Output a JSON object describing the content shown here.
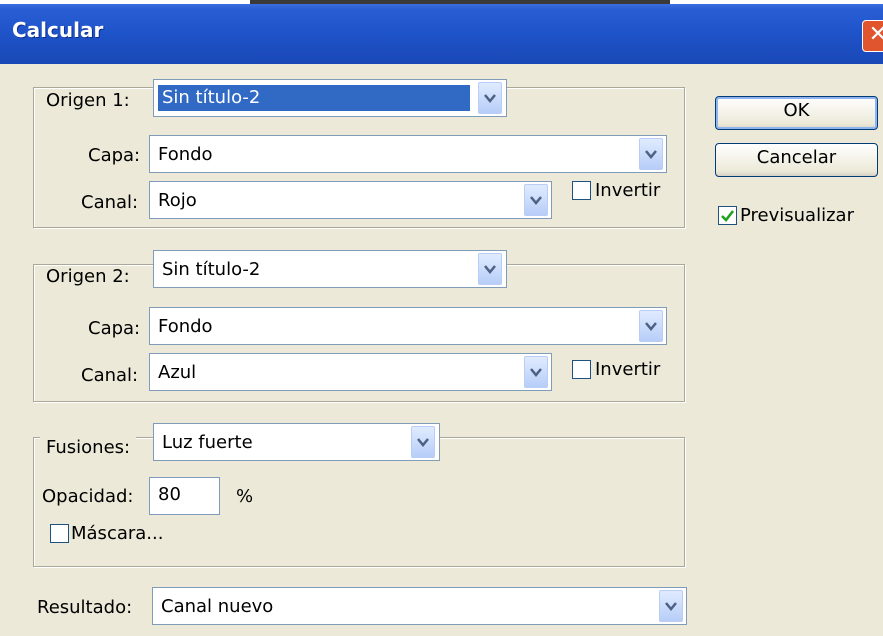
{
  "dialog": {
    "title": "Calcular",
    "close_label": "✕"
  },
  "source1": {
    "origin_label": "Origen 1:",
    "origin_value": "Sin título-2",
    "layer_label": "Capa:",
    "layer_value": "Fondo",
    "channel_label": "Canal:",
    "channel_value": "Rojo",
    "invert_label": "Invertir",
    "invert_checked": false
  },
  "source2": {
    "origin_label": "Origen 2:",
    "origin_value": "Sin título-2",
    "layer_label": "Capa:",
    "layer_value": "Fondo",
    "channel_label": "Canal:",
    "channel_value": "Azul",
    "invert_label": "Invertir",
    "invert_checked": false
  },
  "blending": {
    "mode_label": "Fusiones:",
    "mode_value": "Luz fuerte",
    "opacity_label": "Opacidad:",
    "opacity_value": "80",
    "opacity_unit": "%",
    "mask_label": "Máscara...",
    "mask_checked": false
  },
  "result": {
    "label": "Resultado:",
    "value": "Canal nuevo"
  },
  "buttons": {
    "ok_label": "OK",
    "cancel_label": "Cancelar"
  },
  "preview": {
    "label": "Previsualizar",
    "checked": true
  },
  "colors": {
    "titlebar": "#1e52c8",
    "dialog_bg": "#ece9d8",
    "selection": "#316ac5",
    "close_button": "#e0552e"
  }
}
